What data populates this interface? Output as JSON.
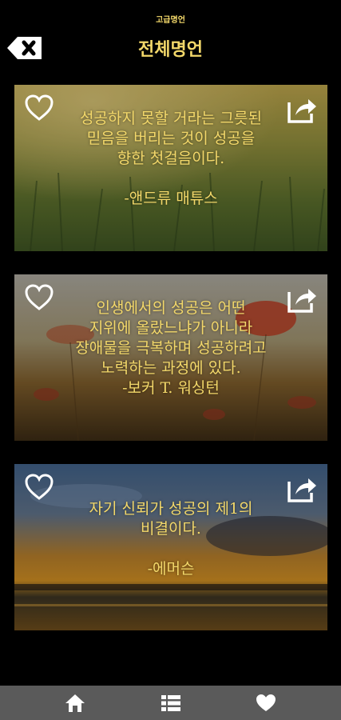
{
  "header": {
    "app_name": "고급명언",
    "title": "전체명언",
    "back_icon": "backspace-icon"
  },
  "colors": {
    "accent": "#f3d86a",
    "background": "#000000",
    "bottom_bar": "#5a5a5a"
  },
  "cards": [
    {
      "quote_lines": [
        "성공하지 못할 거라는 그릇된",
        "믿음을 버리는 것이 성공을",
        "향한 첫걸음이다."
      ],
      "author": "-앤드류 매튜스",
      "background": "wheat-field",
      "icons": [
        "heart-outline-icon",
        "share-icon"
      ]
    },
    {
      "quote_lines": [
        "인생에서의 성공은 어떤",
        "지위에 올랐느냐가 아니라",
        "장애물을 극복하며 성공하려고",
        "노력하는 과정에 있다."
      ],
      "author": "-보커 T. 워싱턴",
      "background": "poppy-field",
      "icons": [
        "heart-outline-icon",
        "share-icon"
      ]
    },
    {
      "quote_lines": [
        "자기 신뢰가 성공의 제1의",
        "비결이다."
      ],
      "author": "-에머슨",
      "background": "sunset-lake",
      "icons": [
        "heart-outline-icon",
        "share-icon"
      ]
    }
  ],
  "bottom_nav": {
    "items": [
      {
        "icon": "home-icon"
      },
      {
        "icon": "list-icon"
      },
      {
        "icon": "heart-icon"
      }
    ]
  }
}
